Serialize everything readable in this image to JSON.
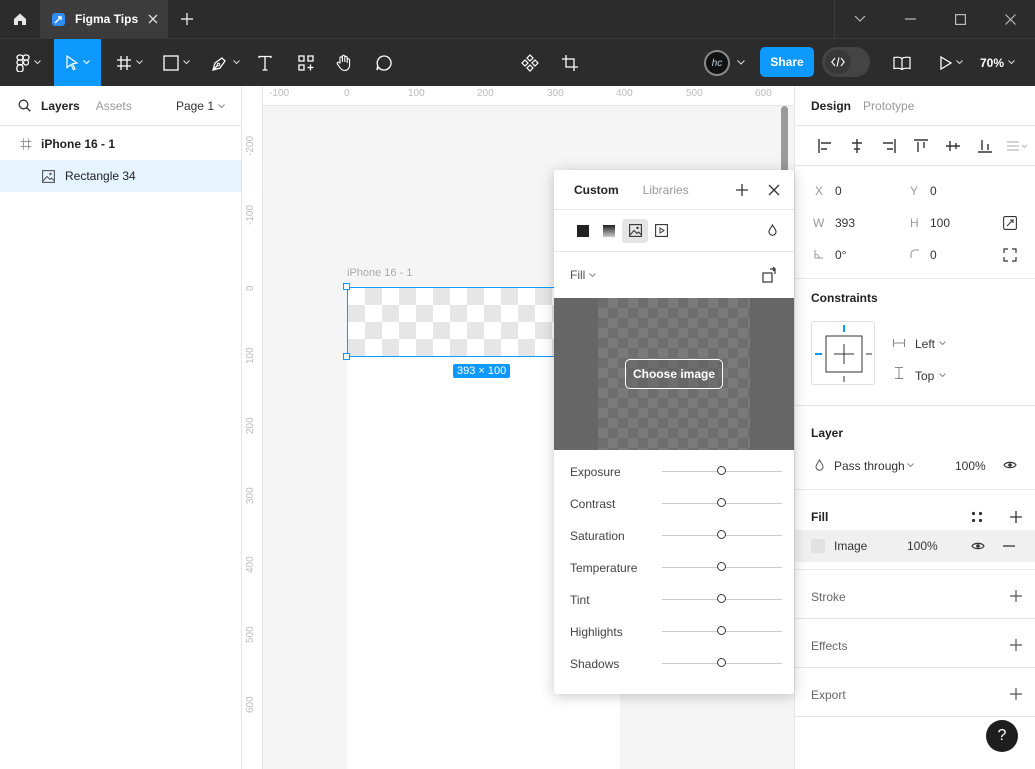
{
  "titlebar": {
    "tab_title": "Figma Tips"
  },
  "toolbar": {
    "share_label": "Share",
    "zoom": "70%",
    "avatar_initials": "hc"
  },
  "left_panel": {
    "tabs": {
      "layers": "Layers",
      "assets": "Assets"
    },
    "page_selector": "Page 1",
    "layers": [
      {
        "name": "iPhone 16 - 1",
        "type": "frame"
      },
      {
        "name": "Rectangle 34",
        "type": "image"
      }
    ]
  },
  "canvas": {
    "ruler_top": [
      "-100",
      "0",
      "100",
      "200",
      "300",
      "400",
      "500",
      "600"
    ],
    "ruler_left": [
      "-200",
      "-100",
      "0",
      "100",
      "200",
      "300",
      "400",
      "500",
      "600"
    ],
    "frame_label": "iPhone 16 - 1",
    "selection_size": "393 × 100"
  },
  "right_panel": {
    "tabs": {
      "design": "Design",
      "prototype": "Prototype"
    },
    "x_label": "X",
    "x_value": "0",
    "y_label": "Y",
    "y_value": "0",
    "w_label": "W",
    "w_value": "393",
    "h_label": "H",
    "h_value": "100",
    "rotation": "0°",
    "corner_radius": "0",
    "constraints": {
      "title": "Constraints",
      "horizontal": "Left",
      "vertical": "Top"
    },
    "layer": {
      "title": "Layer",
      "blend_mode": "Pass through",
      "opacity": "100%"
    },
    "fill": {
      "title": "Fill",
      "type": "Image",
      "opacity": "100%"
    },
    "stroke_title": "Stroke",
    "effects_title": "Effects",
    "export_title": "Export"
  },
  "picker": {
    "tabs": {
      "custom": "Custom",
      "libraries": "Libraries"
    },
    "fill_label": "Fill",
    "choose_image": "Choose image",
    "adjustments": [
      {
        "label": "Exposure",
        "value": 0
      },
      {
        "label": "Contrast",
        "value": 0
      },
      {
        "label": "Saturation",
        "value": 0
      },
      {
        "label": "Temperature",
        "value": 0
      },
      {
        "label": "Tint",
        "value": 0
      },
      {
        "label": "Highlights",
        "value": 0
      },
      {
        "label": "Shadows",
        "value": 0
      }
    ]
  },
  "help_label": "?"
}
